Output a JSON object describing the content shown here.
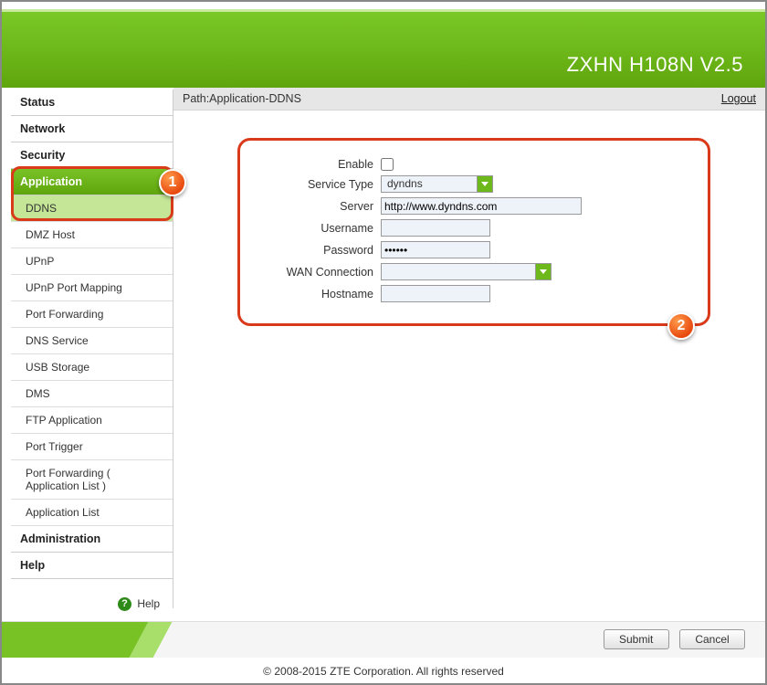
{
  "header": {
    "title": "ZXHN H108N V2.5"
  },
  "breadcrumb": {
    "path": "Path:Application-DDNS",
    "logout": "Logout"
  },
  "sidebar": {
    "top": [
      {
        "label": "Status"
      },
      {
        "label": "Network"
      },
      {
        "label": "Security"
      },
      {
        "label": "Application",
        "active": true
      },
      {
        "label": "Administration"
      },
      {
        "label": "Help"
      }
    ],
    "subs": [
      {
        "label": "DDNS",
        "selected": true
      },
      {
        "label": "DMZ Host"
      },
      {
        "label": "UPnP"
      },
      {
        "label": "UPnP Port Mapping"
      },
      {
        "label": "Port Forwarding"
      },
      {
        "label": "DNS Service"
      },
      {
        "label": "USB Storage"
      },
      {
        "label": "DMS"
      },
      {
        "label": "FTP Application"
      },
      {
        "label": "Port Trigger"
      },
      {
        "label": "Port Forwarding ( Application List )"
      },
      {
        "label": "Application List"
      }
    ],
    "help_label": "Help"
  },
  "form": {
    "labels": {
      "enable": "Enable",
      "service_type": "Service Type",
      "server": "Server",
      "username": "Username",
      "password": "Password",
      "wan": "WAN Connection",
      "hostname": "Hostname"
    },
    "values": {
      "service_type": "dyndns",
      "server": "http://www.dyndns.com",
      "username": "",
      "password": "••••••",
      "wan": "",
      "hostname": ""
    }
  },
  "annotations": {
    "badge1": "1",
    "badge2": "2"
  },
  "footer": {
    "submit": "Submit",
    "cancel": "Cancel",
    "copyright": "© 2008-2015 ZTE Corporation. All rights reserved"
  }
}
